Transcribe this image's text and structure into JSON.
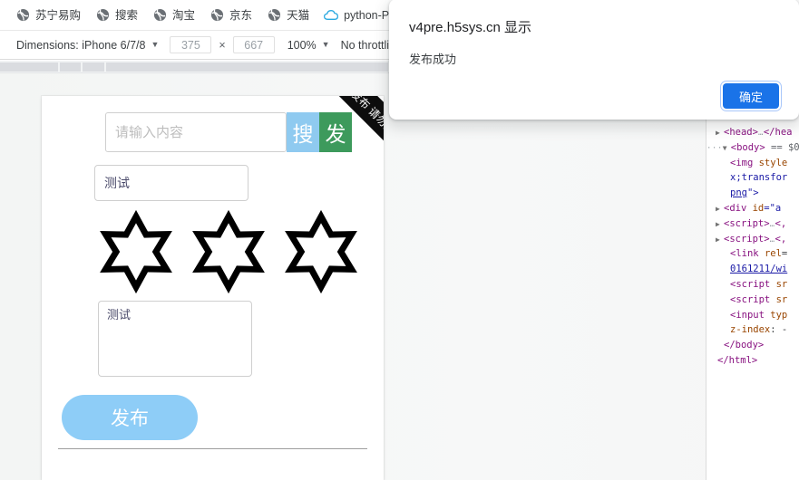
{
  "bookmarks": {
    "items": [
      {
        "label": "苏宁易购",
        "icon": "globe-icon"
      },
      {
        "label": "搜索",
        "icon": "globe-icon"
      },
      {
        "label": "淘宝",
        "icon": "globe-icon"
      },
      {
        "label": "京东",
        "icon": "globe-icon"
      },
      {
        "label": "天猫",
        "icon": "globe-icon"
      },
      {
        "label": "python-P",
        "icon": "cloud-icon"
      }
    ]
  },
  "device_toolbar": {
    "dimensions_label": "Dimensions: iPhone 6/7/8",
    "width": "375",
    "times": "×",
    "height": "667",
    "zoom": "100%",
    "throttling": "No throttling",
    "caret": "▼"
  },
  "page": {
    "search": {
      "placeholder": "请输入内容",
      "value": "",
      "search_button": "搜",
      "publish_button": "发"
    },
    "ribbon": "未发布 请勿分享",
    "title_field": {
      "value": "测试"
    },
    "stars_count": 3,
    "body_field": {
      "value": "测试"
    },
    "publish_button": "发布"
  },
  "devtools": {
    "dom_lines": [
      {
        "arrow": "▶",
        "dots": "",
        "parts": [
          {
            "t": "tw",
            "s": "<head>"
          },
          {
            "t": "dots",
            "s": "…"
          },
          {
            "t": "tw",
            "s": "</hea"
          }
        ],
        "indent": 1
      },
      {
        "arrow": "▼",
        "dots": "···",
        "parts": [
          {
            "t": "tw",
            "s": "<body>"
          },
          {
            "t": "sel",
            "s": " == $0"
          }
        ],
        "indent": 0
      },
      {
        "arrow": "",
        "dots": "",
        "parts": [
          {
            "t": "tw",
            "s": "<img "
          },
          {
            "t": "attr",
            "s": "style"
          }
        ],
        "indent": 2
      },
      {
        "arrow": "",
        "dots": "",
        "parts": [
          {
            "t": "val",
            "s": "x;transfor"
          }
        ],
        "indent": 2
      },
      {
        "arrow": "",
        "dots": "",
        "parts": [
          {
            "t": "link",
            "s": "png"
          },
          {
            "t": "val",
            "s": "\">"
          }
        ],
        "indent": 2
      },
      {
        "arrow": "▶",
        "dots": "",
        "parts": [
          {
            "t": "tw",
            "s": "<div "
          },
          {
            "t": "attr",
            "s": "id"
          },
          {
            "t": "val",
            "s": "=\"a"
          }
        ],
        "indent": 1
      },
      {
        "arrow": "▶",
        "dots": "",
        "parts": [
          {
            "t": "tw",
            "s": "<script>"
          },
          {
            "t": "dots",
            "s": "…"
          },
          {
            "t": "tw",
            "s": "<,"
          }
        ],
        "indent": 1
      },
      {
        "arrow": "▶",
        "dots": "",
        "parts": [
          {
            "t": "tw",
            "s": "<script>"
          },
          {
            "t": "dots",
            "s": "…"
          },
          {
            "t": "tw",
            "s": "<,"
          }
        ],
        "indent": 1
      },
      {
        "arrow": "",
        "dots": "",
        "parts": [
          {
            "t": "tw",
            "s": "<link "
          },
          {
            "t": "attr",
            "s": "rel"
          },
          {
            "t": "plain",
            "s": "="
          }
        ],
        "indent": 2
      },
      {
        "arrow": "",
        "dots": "",
        "parts": [
          {
            "t": "link",
            "s": "0161211/wi"
          }
        ],
        "indent": 2
      },
      {
        "arrow": "",
        "dots": "",
        "parts": [
          {
            "t": "tw",
            "s": "<script "
          },
          {
            "t": "attr",
            "s": "sr"
          }
        ],
        "indent": 2
      },
      {
        "arrow": "",
        "dots": "",
        "parts": [
          {
            "t": "tw",
            "s": "<script "
          },
          {
            "t": "attr",
            "s": "sr"
          }
        ],
        "indent": 2
      },
      {
        "arrow": "",
        "dots": "",
        "parts": [
          {
            "t": "tw",
            "s": "<input "
          },
          {
            "t": "attr",
            "s": "typ"
          }
        ],
        "indent": 2
      },
      {
        "arrow": "",
        "dots": "",
        "parts": [
          {
            "t": "attr",
            "s": "z-index"
          },
          {
            "t": "plain",
            "s": ": -"
          }
        ],
        "indent": 2
      },
      {
        "arrow": "",
        "dots": "",
        "parts": [
          {
            "t": "tw",
            "s": "</body>"
          }
        ],
        "indent": 1
      },
      {
        "arrow": "",
        "dots": "",
        "parts": [
          {
            "t": "tw",
            "s": "</html>"
          }
        ],
        "indent": 0
      }
    ]
  },
  "dialog": {
    "title": "v4pre.h5sys.cn 显示",
    "message": "发布成功",
    "ok_label": "确定"
  },
  "colors": {
    "accent_blue": "#1a73e8",
    "search_btn": "#8fcaf0",
    "green_btn": "#3d9a5c",
    "publish_btn": "#8ecdf7",
    "ribbon_bg": "#0d0d0d"
  }
}
